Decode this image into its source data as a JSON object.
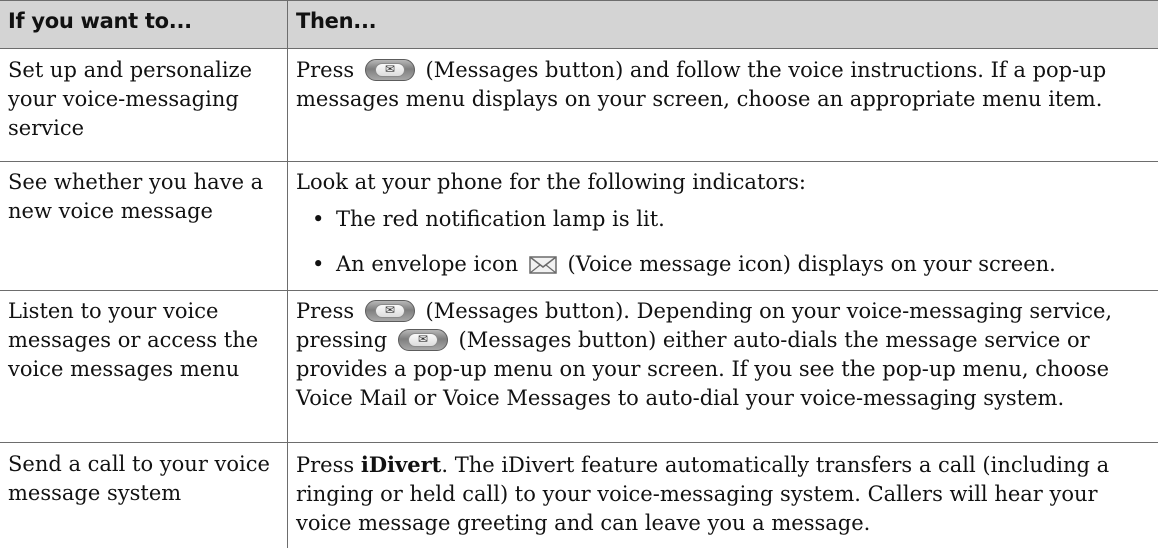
{
  "header": {
    "col1": "If you want to...",
    "col2": "Then..."
  },
  "rows": [
    {
      "left": "Set up and personalize your voice-messaging service",
      "r_press": "Press",
      "r_after": "(Messages button) and follow the voice instructions. If a pop-up messages menu displays on your screen, choose an appropriate menu item."
    },
    {
      "left": "See whether you have a new voice message",
      "intro": "Look at your phone for the following indicators:",
      "bullet": "•",
      "b1": "The red notification lamp is lit.",
      "b2_before": "An envelope icon",
      "b2_after": "(Voice message icon) displays on your screen."
    },
    {
      "left": "Listen to your voice messages or access the voice messages menu",
      "r_press": "Press",
      "r_mid": "(Messages button). Depending on your voice-messaging service, pressing",
      "r_after": "(Messages button) either auto-dials the message service or provides a pop-up menu on your screen. If you see the pop-up menu, choose Voice Mail or Voice Messages to auto-dial your voice-messaging system."
    },
    {
      "left": "Send a call to your voice message system",
      "r_press": "Press",
      "r_key": "iDivert",
      "r_after": ". The iDivert feature automatically transfers a call (including a ringing or held call) to your voice-messaging system. Callers will hear your voice message greeting and can leave you a message."
    }
  ],
  "icons": {
    "messages_button": "envelope-button-icon",
    "voice_message": "envelope-icon",
    "button_glyph": "✉"
  },
  "colors": {
    "header_bg": "#d4d4d4",
    "rule": "#6d6d6d"
  }
}
